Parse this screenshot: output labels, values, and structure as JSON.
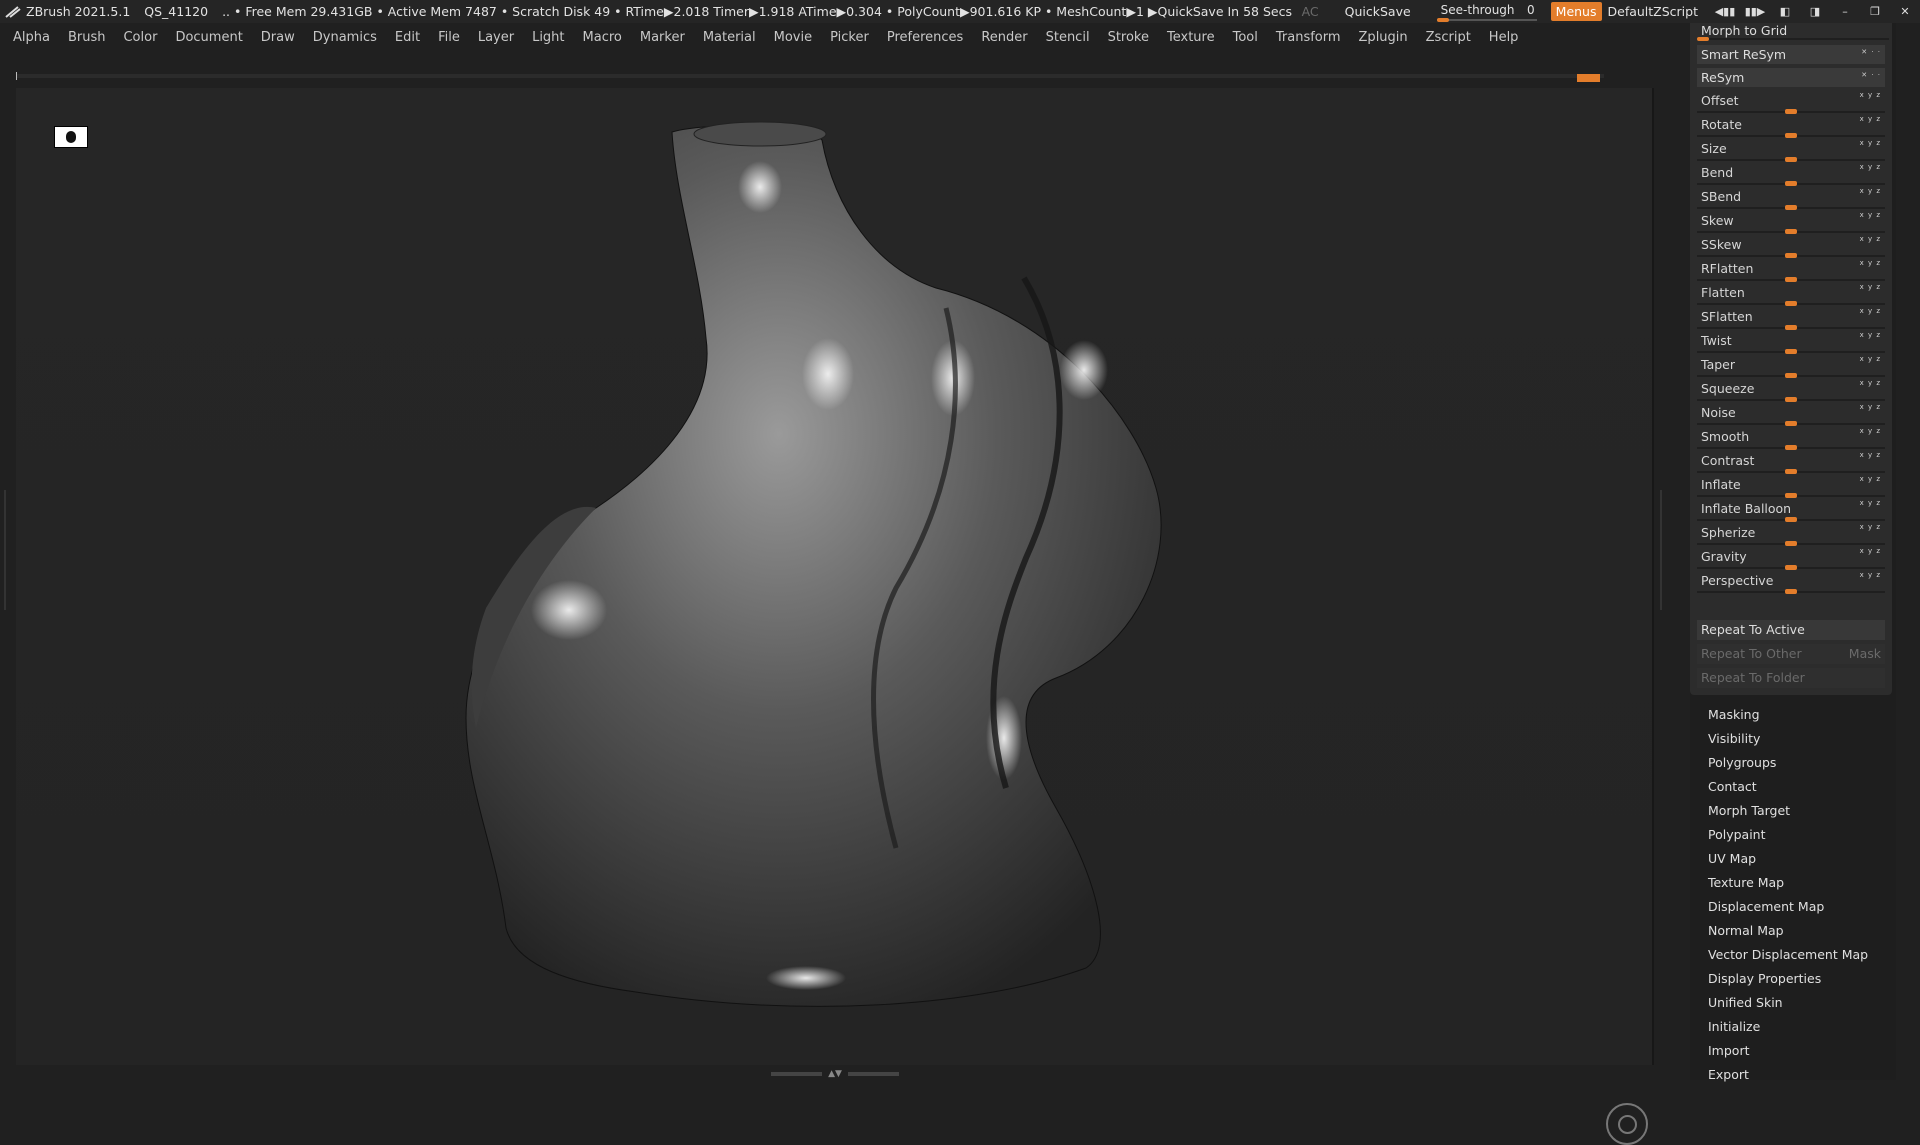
{
  "titlebar": {
    "app": "ZBrush 2021.5.1",
    "doc": "QS_41120",
    "status": ".. • Free Mem 29.431GB • Active Mem 7487 • Scratch Disk 49 • RTime▶2.018 Timer▶1.918 ATime▶0.304 • PolyCount▶901.616 KP • MeshCount▶1 ▶QuickSave In 58 Secs",
    "ac": "AC",
    "quicksave": "QuickSave",
    "seethrough_label": "See-through",
    "seethrough_value": "0",
    "menus": "Menus",
    "script": "DefaultZScript"
  },
  "menubar": [
    "Alpha",
    "Brush",
    "Color",
    "Document",
    "Draw",
    "Dynamics",
    "Edit",
    "File",
    "Layer",
    "Light",
    "Macro",
    "Marker",
    "Material",
    "Movie",
    "Picker",
    "Preferences",
    "Render",
    "Stencil",
    "Stroke",
    "Texture",
    "Tool",
    "Transform",
    "Zplugin",
    "Zscript",
    "Help"
  ],
  "deformation": {
    "morph_to_grid": "Morph to Grid",
    "smart_resym": "Smart ReSym",
    "resym": "ReSym",
    "sliders": [
      {
        "label": "Offset",
        "value": 0
      },
      {
        "label": "Rotate",
        "value": 0
      },
      {
        "label": "Size",
        "value": 0
      },
      {
        "label": "Bend",
        "value": 0
      },
      {
        "label": "SBend",
        "value": 0
      },
      {
        "label": "Skew",
        "value": 0
      },
      {
        "label": "SSkew",
        "value": 0
      },
      {
        "label": "RFlatten",
        "value": 0
      },
      {
        "label": "Flatten",
        "value": 0
      },
      {
        "label": "SFlatten",
        "value": 0
      },
      {
        "label": "Twist",
        "value": 0
      },
      {
        "label": "Taper",
        "value": 0
      },
      {
        "label": "Squeeze",
        "value": 0
      },
      {
        "label": "Noise",
        "value": 0
      },
      {
        "label": "Smooth",
        "value": 0
      },
      {
        "label": "Contrast",
        "value": 0
      },
      {
        "label": "Inflate",
        "value": 0
      },
      {
        "label": "Inflate Balloon",
        "value": 0
      },
      {
        "label": "Spherize",
        "value": 0
      },
      {
        "label": "Gravity",
        "value": 0
      },
      {
        "label": "Perspective",
        "value": 0
      }
    ],
    "repeat_active": "Repeat To Active",
    "repeat_other": "Repeat To Other",
    "mask": "Mask",
    "repeat_folder": "Repeat To Folder"
  },
  "subpalettes": [
    "Masking",
    "Visibility",
    "Polygroups",
    "Contact",
    "Morph Target",
    "Polypaint",
    "UV Map",
    "Texture Map",
    "Displacement Map",
    "Normal Map",
    "Vector Displacement Map",
    "Display Properties",
    "Unified Skin",
    "Initialize",
    "Import",
    "Export"
  ],
  "colors": {
    "accent": "#e37d2b",
    "panel": "#2c2c2c",
    "viewport": "#252525"
  }
}
